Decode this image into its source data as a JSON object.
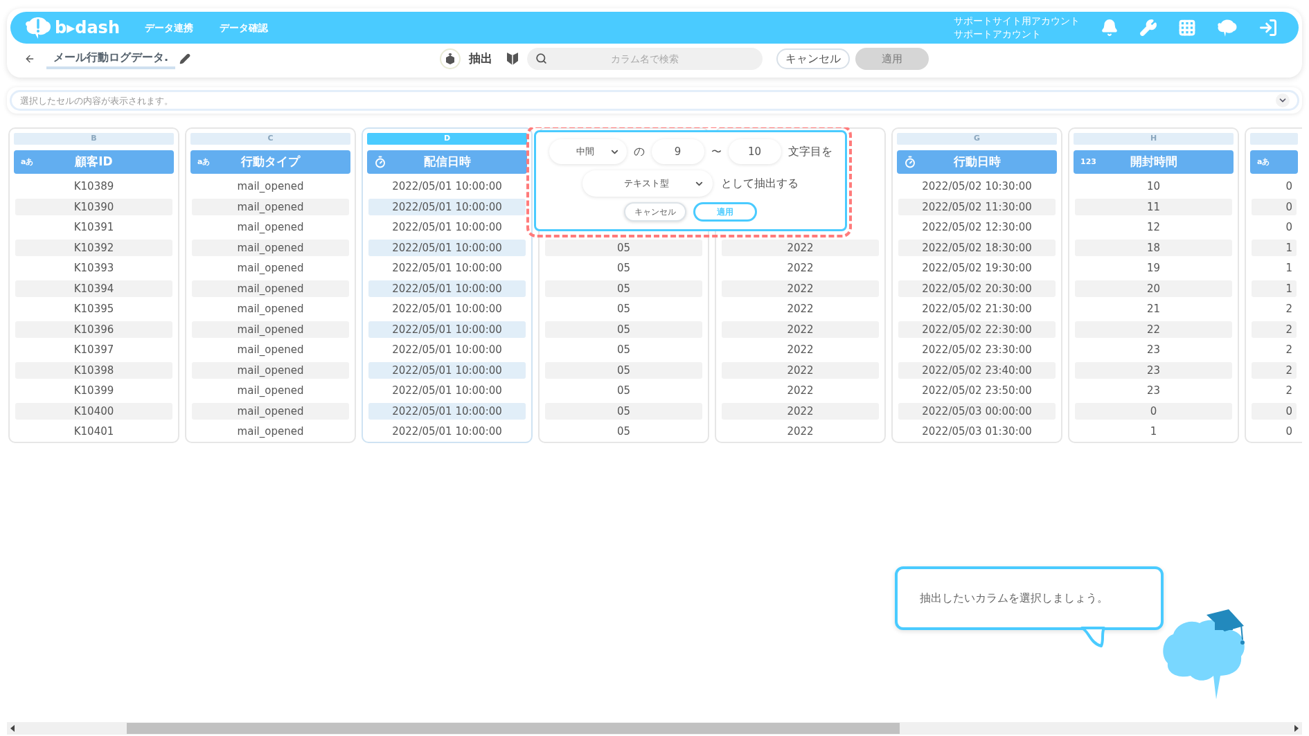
{
  "header": {
    "logo": "b▸dash",
    "nav": [
      "データ連携",
      "データ確認"
    ],
    "account": [
      "サポートサイト用アカウント",
      "サポートアカウント"
    ]
  },
  "toolbar": {
    "title": "メール行動ログデータ.",
    "mode_label": "抽出",
    "search": {
      "placeholder": "カラム名で検索"
    },
    "cancel": "キャンセル",
    "apply": {
      "label": "適用",
      "disabled": true
    }
  },
  "cell_preview": {
    "placeholder": "選択したセルの内容が表示されます。"
  },
  "columns": [
    {
      "letter": "B",
      "name": "顧客ID",
      "kind": "text",
      "type_label": "aあ",
      "selected": false,
      "partial": false,
      "cells": [
        "K10389",
        "K10390",
        "K10391",
        "K10392",
        "K10393",
        "K10394",
        "K10395",
        "K10396",
        "K10397",
        "K10398",
        "K10399",
        "K10400",
        "K10401"
      ]
    },
    {
      "letter": "C",
      "name": "行動タイプ",
      "kind": "text",
      "type_label": "aあ",
      "selected": false,
      "partial": false,
      "cells": [
        "mail_opened",
        "mail_opened",
        "mail_opened",
        "mail_opened",
        "mail_opened",
        "mail_opened",
        "mail_opened",
        "mail_opened",
        "mail_opened",
        "mail_opened",
        "mail_opened",
        "mail_opened",
        "mail_opened"
      ]
    },
    {
      "letter": "D",
      "name": "配信日時",
      "kind": "datetime",
      "selected": true,
      "partial": false,
      "cells": [
        "2022/05/01 10:00:00",
        "2022/05/01 10:00:00",
        "2022/05/01 10:00:00",
        "2022/05/01 10:00:00",
        "2022/05/01 10:00:00",
        "2022/05/01 10:00:00",
        "2022/05/01 10:00:00",
        "2022/05/01 10:00:00",
        "2022/05/01 10:00:00",
        "2022/05/01 10:00:00",
        "2022/05/01 10:00:00",
        "2022/05/01 10:00:00",
        "2022/05/01 10:00:00"
      ]
    },
    {
      "selected": false,
      "partial": false,
      "cells": [
        "05",
        "05",
        "05",
        "05",
        "05",
        "05",
        "05",
        "05",
        "05",
        "05"
      ]
    },
    {
      "selected": false,
      "partial": false,
      "cells": [
        "2022",
        "2022",
        "2022",
        "2022",
        "2022",
        "2022",
        "2022",
        "2022",
        "2022",
        "2022"
      ]
    },
    {
      "letter": "G",
      "name": "行動日時",
      "kind": "datetime",
      "selected": false,
      "partial": false,
      "cells": [
        "2022/05/02 10:30:00",
        "2022/05/02 11:30:00",
        "2022/05/02 12:30:00",
        "2022/05/02 18:30:00",
        "2022/05/02 19:30:00",
        "2022/05/02 20:30:00",
        "2022/05/02 21:30:00",
        "2022/05/02 22:30:00",
        "2022/05/02 23:30:00",
        "2022/05/02 23:40:00",
        "2022/05/02 23:50:00",
        "2022/05/03 00:00:00",
        "2022/05/03 01:30:00"
      ]
    },
    {
      "letter": "H",
      "name": "開封時間",
      "kind": "number",
      "type_label": "123",
      "selected": false,
      "partial": false,
      "cells": [
        "10",
        "11",
        "12",
        "18",
        "19",
        "20",
        "21",
        "22",
        "23",
        "23",
        "23",
        "0",
        "1"
      ]
    },
    {
      "kind": "text",
      "type_label": "aあ",
      "selected": false,
      "partial": true,
      "cells": [
        "0",
        "0",
        "0",
        "1",
        "1",
        "1",
        "2",
        "2",
        "2",
        "2",
        "2",
        "0",
        "0"
      ]
    }
  ],
  "popup": {
    "position_select": "中間",
    "of": "の",
    "from": "9",
    "tilde": "〜",
    "to": "10",
    "suffix": "文字目を",
    "type_select": "テキスト型",
    "extract_as": "として抽出する",
    "cancel": "キャンセル",
    "apply": "適用"
  },
  "guide": {
    "message": "抽出したいカラムを選択しましょう。"
  }
}
